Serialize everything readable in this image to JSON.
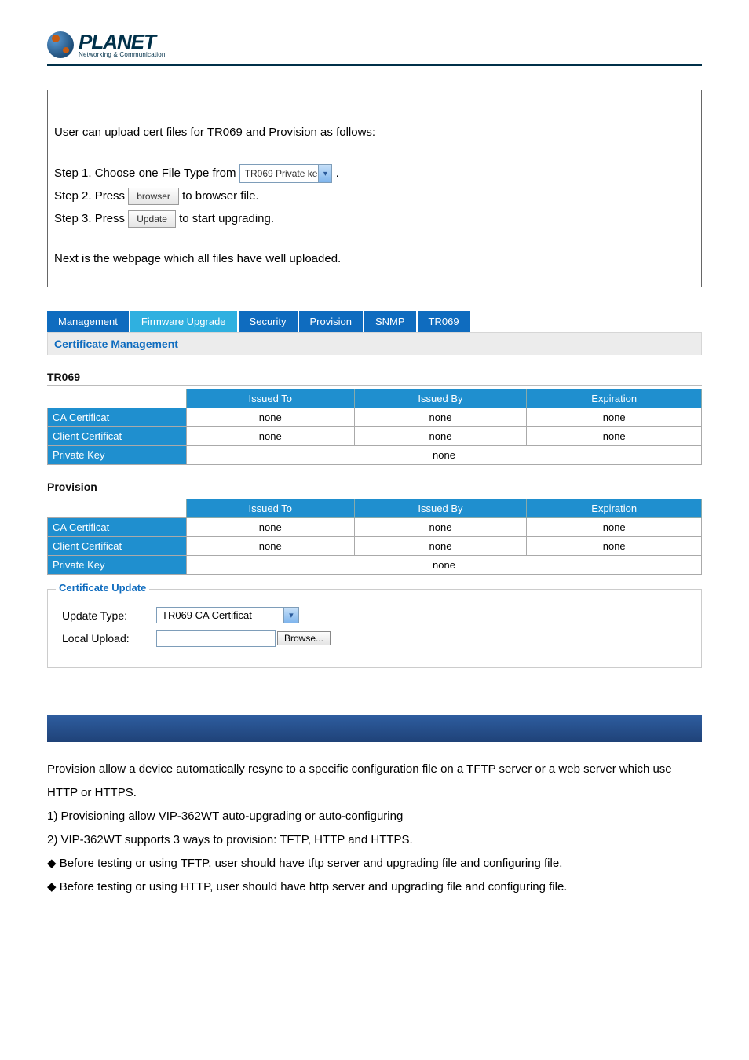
{
  "logo": {
    "brand": "PLANET",
    "tagline": "Networking & Communication"
  },
  "instructions": {
    "intro": "User can upload cert files for TR069 and Provision as follows:",
    "step1_pre": "Step 1. Choose one File Type from ",
    "step1_select": "TR069 Private ke",
    "step1_post": ".",
    "step2_pre": "Step 2. Press ",
    "step2_btn": "browser",
    "step2_post": " to browser file.",
    "step3_pre": "Step 3. Press ",
    "step3_btn": "Update",
    "step3_post": " to start upgrading.",
    "next": "Next is the webpage which all files have well uploaded."
  },
  "tabs": [
    "Management",
    "Firmware Upgrade",
    "Security",
    "Provision",
    "SNMP",
    "TR069"
  ],
  "tabs_active_index": 1,
  "section_title": "Certificate Management",
  "groups": [
    {
      "title": "TR069",
      "headers": [
        "Issued To",
        "Issued By",
        "Expiration"
      ],
      "rows": [
        {
          "label": "CA Certificat",
          "cells": [
            "none",
            "none",
            "none"
          ]
        },
        {
          "label": "Client Certificat",
          "cells": [
            "none",
            "none",
            "none"
          ]
        },
        {
          "label": "Private Key",
          "span": "none"
        }
      ]
    },
    {
      "title": "Provision",
      "headers": [
        "Issued To",
        "Issued By",
        "Expiration"
      ],
      "rows": [
        {
          "label": "CA Certificat",
          "cells": [
            "none",
            "none",
            "none"
          ]
        },
        {
          "label": "Client Certificat",
          "cells": [
            "none",
            "none",
            "none"
          ]
        },
        {
          "label": "Private Key",
          "span": "none"
        }
      ]
    }
  ],
  "cert_update": {
    "legend": "Certificate Update",
    "row1_label": "Update Type:",
    "row1_value": "TR069 CA Certificat",
    "row2_label": "Local Upload:",
    "row2_button": "Browse..."
  },
  "prose": {
    "p1": "Provision allow a device automatically resync to a specific configuration file on a TFTP server or a web server which use HTTP or HTTPS.",
    "items": [
      "1)    Provisioning allow VIP-362WT auto-upgrading or auto-configuring",
      "2)    VIP-362WT supports 3 ways to provision: TFTP, HTTP and HTTPS.",
      "◆     Before testing or using TFTP, user should have tftp server and upgrading file and configuring file.",
      "◆     Before testing or using HTTP, user should have http server and upgrading file and configuring file."
    ]
  }
}
